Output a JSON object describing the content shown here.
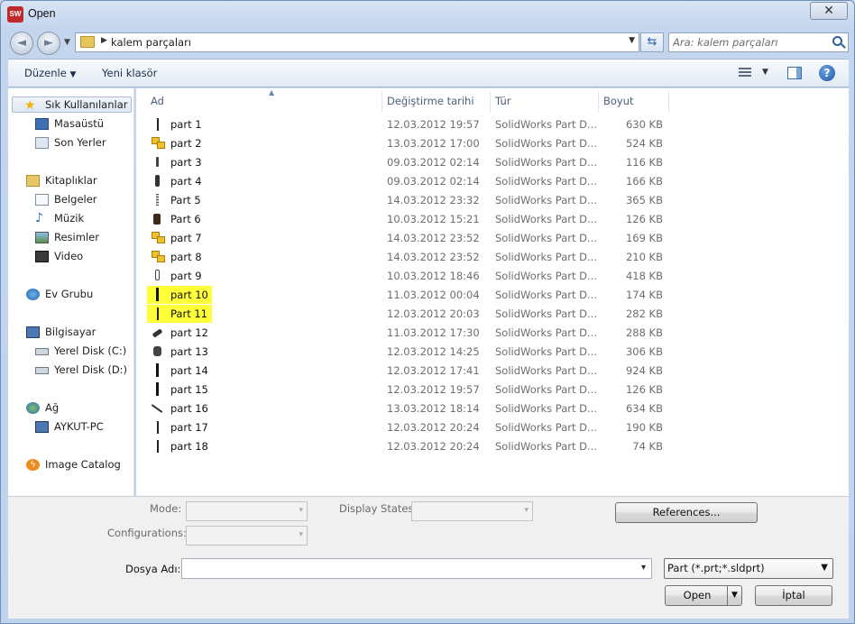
{
  "window": {
    "title": "Open",
    "app_badge": "SW",
    "close_glyph": "✕"
  },
  "nav": {
    "back_glyph": "◄",
    "forward_glyph": "►",
    "breadcrumb": "kalem parçaları",
    "search_placeholder": "Ara: kalem parçaları"
  },
  "toolbar": {
    "organize": "Düzenle",
    "new_folder": "Yeni klasör",
    "help": "?"
  },
  "sidebar": {
    "favorites": {
      "label": "Sık Kullanılanlar",
      "items": [
        "Masaüstü",
        "Son Yerler"
      ]
    },
    "libraries": {
      "label": "Kitaplıklar",
      "items": [
        "Belgeler",
        "Müzik",
        "Resimler",
        "Video"
      ]
    },
    "homegroup": "Ev Grubu",
    "computer": {
      "label": "Bilgisayar",
      "items": [
        "Yerel Disk (C:)",
        "Yerel Disk (D:)"
      ]
    },
    "network": {
      "label": "Ağ",
      "items": [
        "AYKUT-PC"
      ]
    },
    "image_catalog": "Image Catalog"
  },
  "columns": {
    "name": "Ad",
    "date": "Değiştirme tarihi",
    "type": "Tür",
    "size": "Boyut"
  },
  "files": [
    {
      "name": "part 1",
      "date": "12.03.2012 19:57",
      "type": "SolidWorks Part D...",
      "size": "630 KB",
      "icon": "thin-rod-icon"
    },
    {
      "name": "part 2",
      "date": "13.03.2012 17:00",
      "type": "SolidWorks Part D...",
      "size": "524 KB",
      "icon": "assembly-cubes-icon"
    },
    {
      "name": "part 3",
      "date": "09.03.2012 02:14",
      "type": "SolidWorks Part D...",
      "size": "116 KB",
      "icon": "pen-tip-icon"
    },
    {
      "name": "part 4",
      "date": "09.03.2012 02:14",
      "type": "SolidWorks Part D...",
      "size": "166 KB",
      "icon": "pen-body-icon"
    },
    {
      "name": "Part 5",
      "date": "14.03.2012 23:32",
      "type": "SolidWorks Part D...",
      "size": "365 KB",
      "icon": "spring-icon"
    },
    {
      "name": "Part 6",
      "date": "10.03.2012 15:21",
      "type": "SolidWorks Part D...",
      "size": "126 KB",
      "icon": "cap-icon"
    },
    {
      "name": "part 7",
      "date": "14.03.2012 23:52",
      "type": "SolidWorks Part D...",
      "size": "169 KB",
      "icon": "assembly-cubes-icon"
    },
    {
      "name": "part 8",
      "date": "14.03.2012 23:52",
      "type": "SolidWorks Part D...",
      "size": "210 KB",
      "icon": "assembly-cubes-icon"
    },
    {
      "name": "part 9",
      "date": "10.03.2012 18:46",
      "type": "SolidWorks Part D...",
      "size": "418 KB",
      "icon": "clip-icon"
    },
    {
      "name": "part 10",
      "date": "11.03.2012 00:04",
      "type": "SolidWorks Part D...",
      "size": "174 KB",
      "icon": "thick-rod-icon",
      "highlighted": true
    },
    {
      "name": "Part 11",
      "date": "12.03.2012 20:03",
      "type": "SolidWorks Part D...",
      "size": "282 KB",
      "icon": "thin-rod-icon",
      "highlighted": true
    },
    {
      "name": "part 12",
      "date": "11.03.2012 17:30",
      "type": "SolidWorks Part D...",
      "size": "288 KB",
      "icon": "grip-icon"
    },
    {
      "name": "part 13",
      "date": "12.03.2012 14:25",
      "type": "SolidWorks Part D...",
      "size": "306 KB",
      "icon": "button-icon"
    },
    {
      "name": "part 14",
      "date": "12.03.2012 17:41",
      "type": "SolidWorks Part D...",
      "size": "924 KB",
      "icon": "thick-rod-icon"
    },
    {
      "name": "part 15",
      "date": "12.03.2012 19:57",
      "type": "SolidWorks Part D...",
      "size": "126 KB",
      "icon": "thick-rod-icon"
    },
    {
      "name": "part 16",
      "date": "13.03.2012 18:14",
      "type": "SolidWorks Part D...",
      "size": "634 KB",
      "icon": "diagonal-rod-icon"
    },
    {
      "name": "part 17",
      "date": "12.03.2012 20:24",
      "type": "SolidWorks Part D...",
      "size": "190 KB",
      "icon": "thin-rod-icon"
    },
    {
      "name": "part 18",
      "date": "12.03.2012 20:24",
      "type": "SolidWorks Part D...",
      "size": "74 KB",
      "icon": "thin-rod-icon"
    }
  ],
  "bottom": {
    "mode_label": "Mode:",
    "display_states_label": "Display States:",
    "configurations_label": "Configurations:",
    "references_button": "References...",
    "filename_label": "Dosya Adı:",
    "filename_value": "",
    "filter_value": "Part (*.prt;*.sldprt)",
    "open_button": "Open",
    "cancel_button": "İptal"
  },
  "colors": {
    "highlight": "#ffff3a",
    "accent": "#2f5f9d"
  }
}
